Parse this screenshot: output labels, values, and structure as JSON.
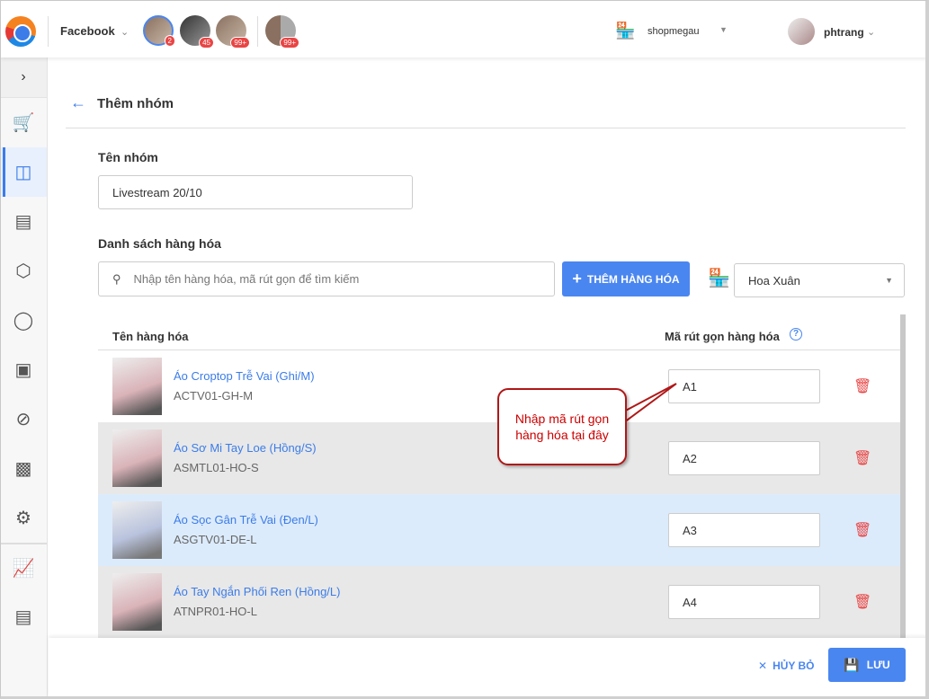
{
  "header": {
    "channel": "Facebook",
    "badges": [
      "2",
      "45",
      "99+",
      "99+"
    ],
    "shop": "shopmegau",
    "user": "phtrang"
  },
  "sidebar": {
    "items": [
      "cart",
      "video",
      "orders",
      "products",
      "messenger",
      "customers",
      "block",
      "bot",
      "settings",
      "reports",
      "history"
    ]
  },
  "page": {
    "title": "Thêm nhóm",
    "group_name_label": "Tên nhóm",
    "group_name_value": "Livestream 20/10",
    "products_label": "Danh sách hàng hóa",
    "search_placeholder": "Nhập tên hàng hóa, mã rút gọn để tìm kiếm",
    "add_button": "THÊM HÀNG HÓA",
    "branch": "Hoa Xuân"
  },
  "table": {
    "col_name": "Tên hàng hóa",
    "col_code": "Mã rút gọn hàng hóa",
    "rows": [
      {
        "name": "Áo Croptop Trễ Vai (Ghi/M)",
        "sku": "ACTV01-GH-M",
        "code": "A1"
      },
      {
        "name": "Áo Sơ Mi Tay Loe (Hồng/S)",
        "sku": "ASMTL01-HO-S",
        "code": "A2"
      },
      {
        "name": "Áo Sọc Gân Trễ Vai (Đen/L)",
        "sku": "ASGTV01-DE-L",
        "code": "A3"
      },
      {
        "name": "Áo Tay Ngắn Phối Ren (Hồng/L)",
        "sku": "ATNPR01-HO-L",
        "code": "A4"
      }
    ]
  },
  "callout": {
    "line1": "Nhập mã rút gọn",
    "line2": "hàng hóa tại đây"
  },
  "footer": {
    "cancel": "HỦY BỎ",
    "save": "LƯU"
  },
  "colors": {
    "accent": "#4a86f0",
    "danger": "#e94545",
    "row_alt": "#e8e8e8",
    "row_selected": "#dcebfb"
  }
}
